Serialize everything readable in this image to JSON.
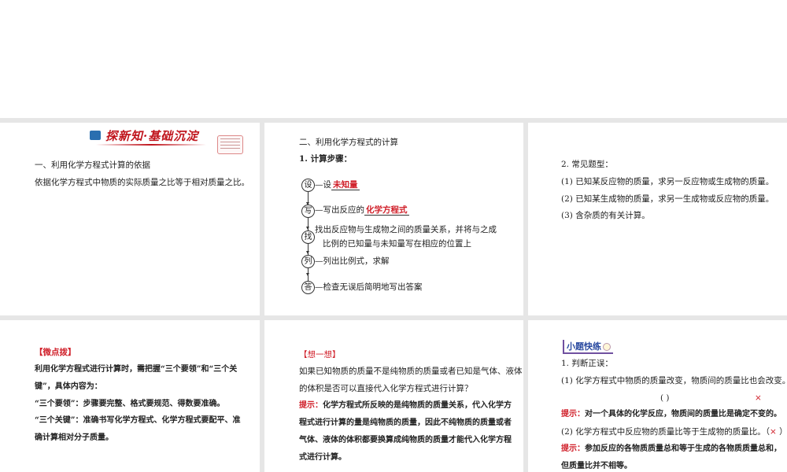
{
  "slide1": {
    "banner_title": "探新知·基础沉淀",
    "heading": "一、利用化学方程式计算的依据",
    "body": "依据化学方程式中物质的实际质量之比等于相对质量之比。"
  },
  "slide2": {
    "heading": "二、利用化学方程式的计算",
    "subheading": "1. 计算步骤：",
    "steps": [
      {
        "circle": "设",
        "text": "—设",
        "blank": "未知量"
      },
      {
        "circle": "写",
        "text": "—写出反应的",
        "blank": "化学方程式"
      },
      {
        "circle": "找",
        "line1": "找出反应物与生成物之间的质量关系，并将与之成",
        "line2": "比例的已知量与未知量写在相应的位置上"
      },
      {
        "circle": "列",
        "text": "—列出比例式，求解"
      },
      {
        "circle": "答",
        "text": "—检查无误后简明地写出答案"
      }
    ]
  },
  "slide3": {
    "heading": "2. 常见题型：",
    "items": [
      "(1) 已知某反应物的质量，求另一反应物或生成物的质量。",
      "(2) 已知某生成物的质量，求另一生成物或反应物的质量。",
      "(3) 含杂质的有关计算。"
    ]
  },
  "slide4": {
    "tag": "【微点拨】",
    "lines": [
      "利用化学方程式进行计算时，需把握“三个要领”和“三个关",
      "键”，具体内容为：",
      "“三个要领”：步骤要完整、格式要规范、得数要准确。",
      "“三个关键”：准确书写化学方程式、化学方程式要配平、准",
      "确计算相对分子质量。"
    ]
  },
  "slide5": {
    "tag": "【想一想】",
    "question": [
      "如果已知物质的质量不是纯物质的质量或者已知是气体、液体",
      "的体积是否可以直接代入化学方程式进行计算？"
    ],
    "hint_label": "提示：",
    "hint": [
      "化学方程式所反映的是纯物质的质量关系，代入化学方",
      "程式进行计算的量是纯物质的质量，因此不纯物质的质量或者",
      "气体、液体的体积都要换算成纯物质的质量才能代入化学方程",
      "式进行计算。"
    ]
  },
  "slide6": {
    "tag": "小题快练",
    "heading": "1. 判断正误：",
    "q1": "(1) 化学方程式中物质的质量改变，物质间的质量比也会改变。",
    "q1_paren": "(    )",
    "q1_answer": "×",
    "hint_label": "提示：",
    "hint1": "对一个具体的化学反应，物质间的质量比是确定不变的。",
    "q2": "(2) 化学方程式中反应物的质量比等于生成物的质量比。（",
    "q2_answer": "×",
    "q2_close": " ）",
    "hint2": [
      "参加反应的各物质质量总和等于生成的各物质质量总和，",
      "但质量比并不相等。"
    ]
  }
}
